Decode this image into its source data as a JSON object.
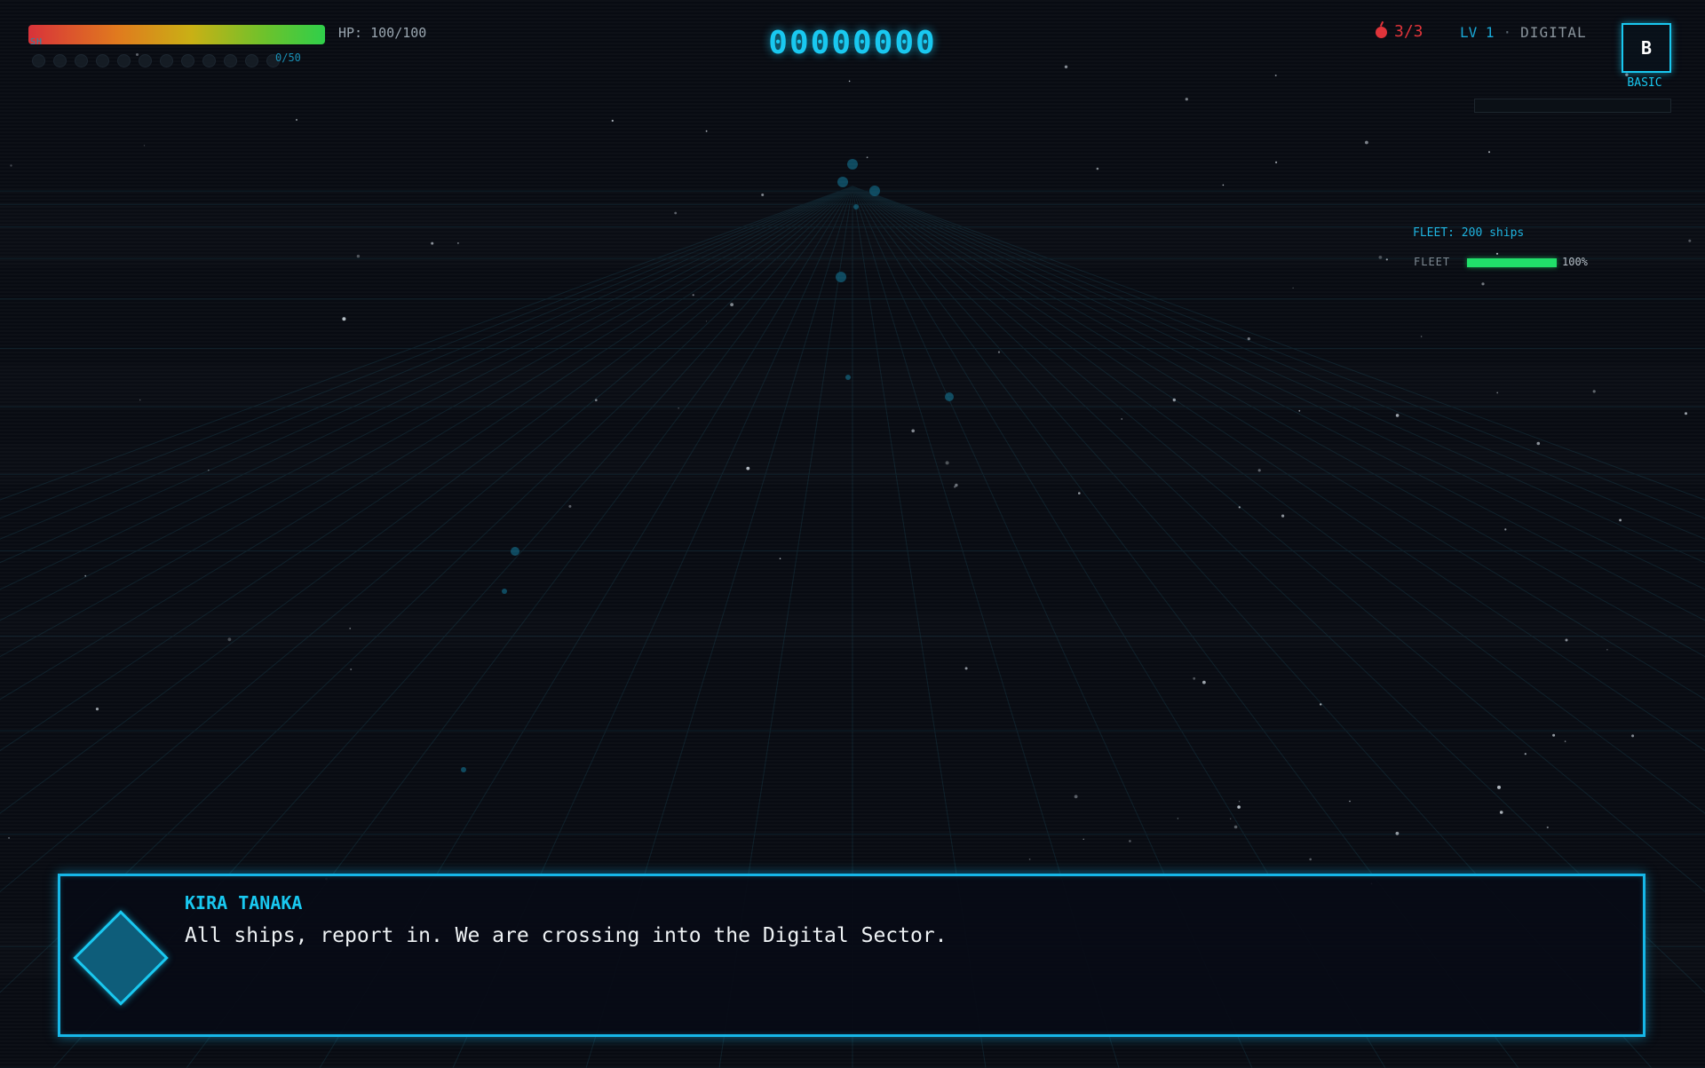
{
  "hud": {
    "hp_label": "HP: 100/100",
    "hp_fraction": 1.0,
    "shield_label": "SH",
    "shield_count": "0/50",
    "shield_pips": 12,
    "score": "00000000",
    "lives": "3/3",
    "lives_icon": "bomb-icon",
    "level": "LV 1",
    "separator": "·",
    "sector": "DIGITAL",
    "weapon_letter": "B",
    "weapon_name": "BASIC",
    "weapon_charge_fraction": 0.0
  },
  "fleet": {
    "count_label": "FLEET: 200 ships",
    "bar_label": "FLEET",
    "percent": "100%",
    "fraction": 1.0
  },
  "dialogue": {
    "speaker": "KIRA TANAKA",
    "text": "All ships, report in. We are crossing into the Digital Sector.",
    "portrait_icon": "diamond-portrait-icon"
  },
  "colors": {
    "accent": "#19c8f0",
    "background": "#080b12",
    "lives": "#e0343a",
    "fleet_bar": "#21e06a"
  }
}
